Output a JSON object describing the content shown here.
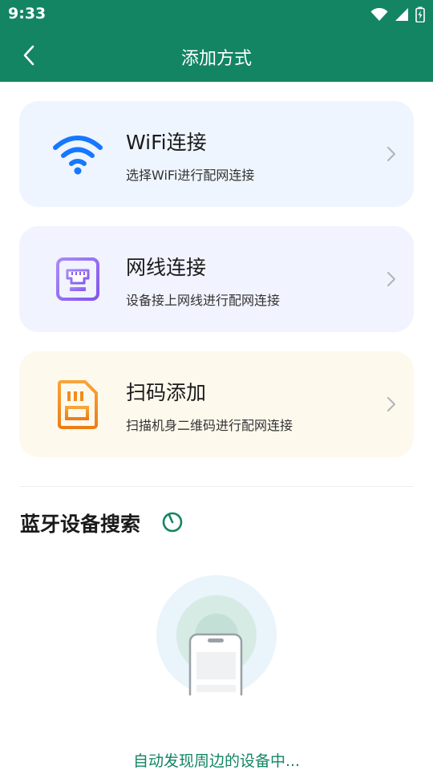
{
  "status_bar": {
    "time": "9:33"
  },
  "header": {
    "title": "添加方式"
  },
  "options": [
    {
      "title": "WiFi连接",
      "subtitle": "选择WiFi进行配网连接",
      "icon": "wifi-icon",
      "bg": "#eef5fe"
    },
    {
      "title": "网线连接",
      "subtitle": "设备接上网线进行配网连接",
      "icon": "ethernet-port-icon",
      "bg": "#f1f3fe"
    },
    {
      "title": "扫码添加",
      "subtitle": "扫描机身二维码进行配网连接",
      "icon": "sim-card-icon",
      "bg": "#fef9ed"
    }
  ],
  "bluetooth": {
    "title": "蓝牙设备搜索",
    "status": "自动发现周边的设备中..."
  },
  "colors": {
    "primary": "#138563",
    "wifi": "#1677ff",
    "ethernet": "#8b5cf6",
    "scan": "#f08c1e"
  }
}
